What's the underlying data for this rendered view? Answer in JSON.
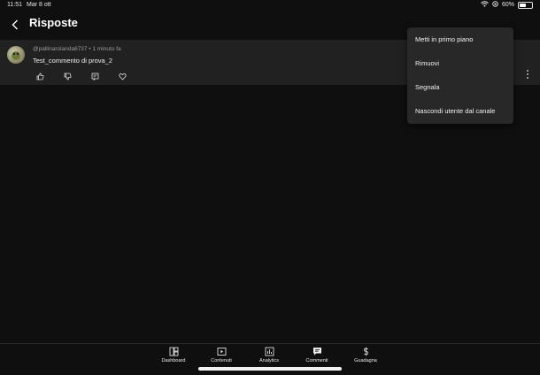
{
  "status_bar": {
    "time": "11:51",
    "date": "Mar 8 ott",
    "battery": "60%"
  },
  "header": {
    "title": "Risposte"
  },
  "comment": {
    "handle": "@pallinarolanda6737",
    "time_ago": "• 1 minuto fa",
    "text": "Test_commento di prova_2"
  },
  "context_menu": {
    "items": [
      "Metti in primo piano",
      "Rimuovi",
      "Segnala",
      "Nascondi utente dal canale"
    ]
  },
  "bottom_nav": {
    "items": [
      {
        "label": "Dashboard",
        "icon": "dashboard-icon"
      },
      {
        "label": "Contenuti",
        "icon": "content-icon"
      },
      {
        "label": "Analytics",
        "icon": "analytics-icon"
      },
      {
        "label": "Commenti",
        "icon": "comments-icon"
      },
      {
        "label": "Guadagna",
        "icon": "earn-icon"
      }
    ]
  },
  "colors": {
    "background": "#0f0f0f",
    "surface": "#212121",
    "menu": "#282828",
    "text": "#f1f1f1",
    "muted": "#9a9a9a"
  }
}
